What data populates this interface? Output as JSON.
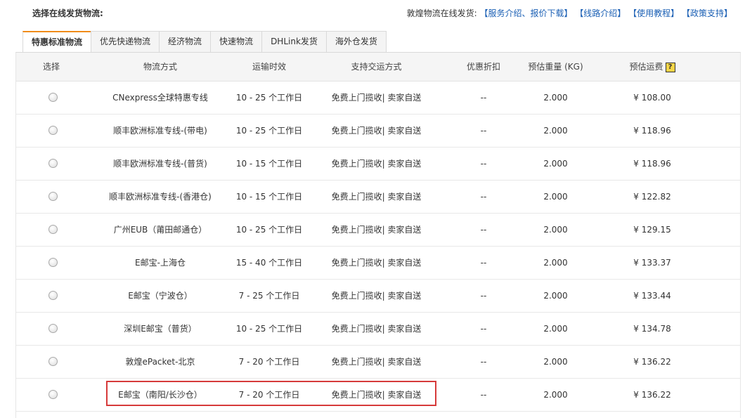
{
  "header": {
    "section_title": "选择在线发货物流:",
    "prefix": "敦煌物流在线发货:",
    "links": [
      "【服务介绍、报价下载】",
      "【线路介绍】",
      "【使用教程】",
      "【政策支持】"
    ]
  },
  "tabs": [
    {
      "label": "特惠标准物流",
      "active": true
    },
    {
      "label": "优先快递物流",
      "active": false
    },
    {
      "label": "经济物流",
      "active": false
    },
    {
      "label": "快速物流",
      "active": false
    },
    {
      "label": "DHLink发货",
      "active": false
    },
    {
      "label": "海外仓发货",
      "active": false
    }
  ],
  "table": {
    "columns": {
      "select": "选择",
      "method": "物流方式",
      "time": "运输时效",
      "handover": "支持交运方式",
      "discount": "优惠折扣",
      "weight": "预估重量 (KG)",
      "fee": "预估运费",
      "fee_help": "?"
    },
    "rows": [
      {
        "method": "CNexpress全球特惠专线",
        "time": "10 - 25 个工作日",
        "handover": "免费上门揽收| 卖家自送",
        "discount": "--",
        "weight": "2.000",
        "fee": "¥ 108.00"
      },
      {
        "method": "顺丰欧洲标准专线-(带电)",
        "time": "10 - 25 个工作日",
        "handover": "免费上门揽收| 卖家自送",
        "discount": "--",
        "weight": "2.000",
        "fee": "¥ 118.96"
      },
      {
        "method": "顺丰欧洲标准专线-(普货)",
        "time": "10 - 15 个工作日",
        "handover": "免费上门揽收| 卖家自送",
        "discount": "--",
        "weight": "2.000",
        "fee": "¥ 118.96"
      },
      {
        "method": "顺丰欧洲标准专线-(香港仓)",
        "time": "10 - 15 个工作日",
        "handover": "免费上门揽收| 卖家自送",
        "discount": "--",
        "weight": "2.000",
        "fee": "¥ 122.82"
      },
      {
        "method": "广州EUB（莆田邮通仓）",
        "time": "10 - 25 个工作日",
        "handover": "免费上门揽收| 卖家自送",
        "discount": "--",
        "weight": "2.000",
        "fee": "¥ 129.15"
      },
      {
        "method": "E邮宝-上海仓",
        "time": "15 - 40 个工作日",
        "handover": "免费上门揽收| 卖家自送",
        "discount": "--",
        "weight": "2.000",
        "fee": "¥ 133.37"
      },
      {
        "method": "E邮宝（宁波仓）",
        "time": "7 - 25 个工作日",
        "handover": "免费上门揽收| 卖家自送",
        "discount": "--",
        "weight": "2.000",
        "fee": "¥ 133.44"
      },
      {
        "method": "深圳E邮宝（普货）",
        "time": "10 - 25 个工作日",
        "handover": "免费上门揽收| 卖家自送",
        "discount": "--",
        "weight": "2.000",
        "fee": "¥ 134.78"
      },
      {
        "method": "敦煌ePacket-北京",
        "time": "7 - 20 个工作日",
        "handover": "免费上门揽收| 卖家自送",
        "discount": "--",
        "weight": "2.000",
        "fee": "¥ 136.22"
      },
      {
        "method": "E邮宝（南阳/长沙仓）",
        "time": "7 - 20 个工作日",
        "handover": "免费上门揽收| 卖家自送",
        "discount": "--",
        "weight": "2.000",
        "fee": "¥ 136.22"
      }
    ]
  },
  "colors": {
    "link": "#1a5fb4",
    "active_tab_accent": "#f08c1a",
    "highlight_border": "#d63a3a"
  }
}
